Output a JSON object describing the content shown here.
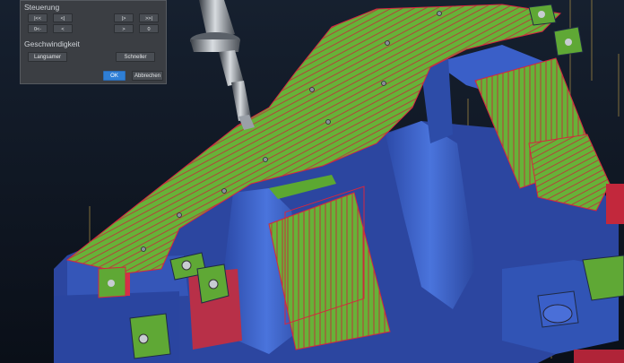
{
  "panel": {
    "steuerung_title": "Steuerung",
    "controls_row1": [
      "|<<",
      "<|",
      "|>",
      ">>|"
    ],
    "controls_row2": [
      "0<-",
      "<",
      ">",
      "0"
    ],
    "geschwindigkeit_title": "Geschwindigkeit",
    "slower_label": "Langsamer",
    "faster_label": "Schneller",
    "ok_label": "OK",
    "cancel_label": "Abbrechen"
  },
  "colors": {
    "background": "#0d1420",
    "panel": "#3b3e43",
    "part_blue": "#3f63c9",
    "toolpath_green": "#6fba3a",
    "toolpath_red": "#d6263f",
    "accent": "#2f7fd6"
  }
}
